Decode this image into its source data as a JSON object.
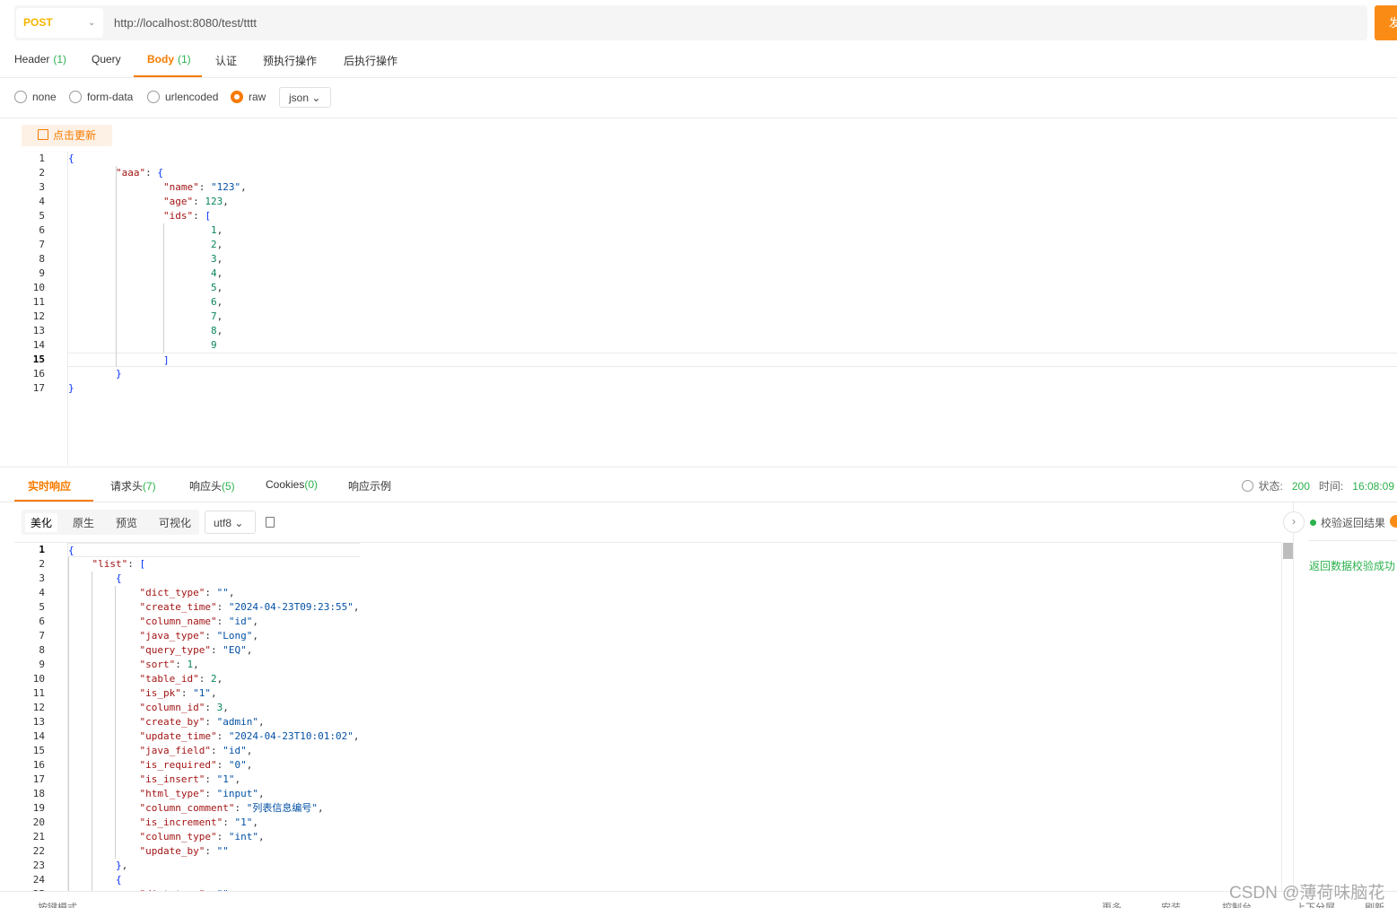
{
  "request": {
    "method": "POST",
    "url": "http://localhost:8080/test/tttt",
    "send_label": "发"
  },
  "request_tabs": [
    {
      "label": "Header",
      "count": "(1)"
    },
    {
      "label": "Query",
      "count": ""
    },
    {
      "label": "Body",
      "count": "(1)"
    },
    {
      "label": "认证",
      "count": ""
    },
    {
      "label": "预执行操作",
      "count": ""
    },
    {
      "label": "后执行操作",
      "count": ""
    }
  ],
  "active_request_tab": "Body",
  "body_modes": [
    "none",
    "form-data",
    "urlencoded",
    "raw"
  ],
  "selected_body_mode": "raw",
  "raw_format": "json",
  "update_button": "点击更新",
  "request_body_lines": [
    "{",
    "        \"aaa\": {",
    "                \"name\": \"123\",",
    "                \"age\": 123,",
    "                \"ids\": [",
    "                        1,",
    "                        2,",
    "                        3,",
    "                        4,",
    "                        5,",
    "                        6,",
    "                        7,",
    "                        8,",
    "                        9",
    "                ]",
    "        }",
    "}"
  ],
  "request_cursor_line": 15,
  "response_tabs": [
    {
      "label": "实时响应",
      "count": ""
    },
    {
      "label": "请求头",
      "count": "(7)"
    },
    {
      "label": "响应头",
      "count": "(5)"
    },
    {
      "label": "Cookies",
      "count": "(0)"
    },
    {
      "label": "响应示例",
      "count": ""
    }
  ],
  "active_response_tab": "实时响应",
  "status": {
    "status_label": "状态:",
    "status_code": "200",
    "time_label": "时间:",
    "time_value": "16:08:09"
  },
  "view_modes": [
    "美化",
    "原生",
    "预览",
    "可视化"
  ],
  "active_view_mode": "美化",
  "charset": "utf8",
  "response_body_lines": [
    "{",
    "    \"list\": [",
    "        {",
    "            \"dict_type\": \"\",",
    "            \"create_time\": \"2024-04-23T09:23:55\",",
    "            \"column_name\": \"id\",",
    "            \"java_type\": \"Long\",",
    "            \"query_type\": \"EQ\",",
    "            \"sort\": 1,",
    "            \"table_id\": 2,",
    "            \"is_pk\": \"1\",",
    "            \"column_id\": 3,",
    "            \"create_by\": \"admin\",",
    "            \"update_time\": \"2024-04-23T10:01:02\",",
    "            \"java_field\": \"id\",",
    "            \"is_required\": \"0\",",
    "            \"is_insert\": \"1\",",
    "            \"html_type\": \"input\",",
    "            \"column_comment\": \"列表信息编号\",",
    "            \"is_increment\": \"1\",",
    "            \"column_type\": \"int\",",
    "            \"update_by\": \"\"",
    "        },",
    "        {",
    "            \"dict_type\": \"\","
  ],
  "response_cursor_line": 1,
  "validation": {
    "label": "校验返回结果",
    "result": "返回数据校验成功"
  },
  "bottom_bar": [
    "按键模式",
    "更多",
    "安装",
    "控制台",
    "上下分屏",
    "刷新"
  ],
  "watermark": "CSDN @薄荷味脑花",
  "colors": {
    "accent": "#f77b00",
    "method": "#f7b500",
    "success": "#2bb24c"
  }
}
